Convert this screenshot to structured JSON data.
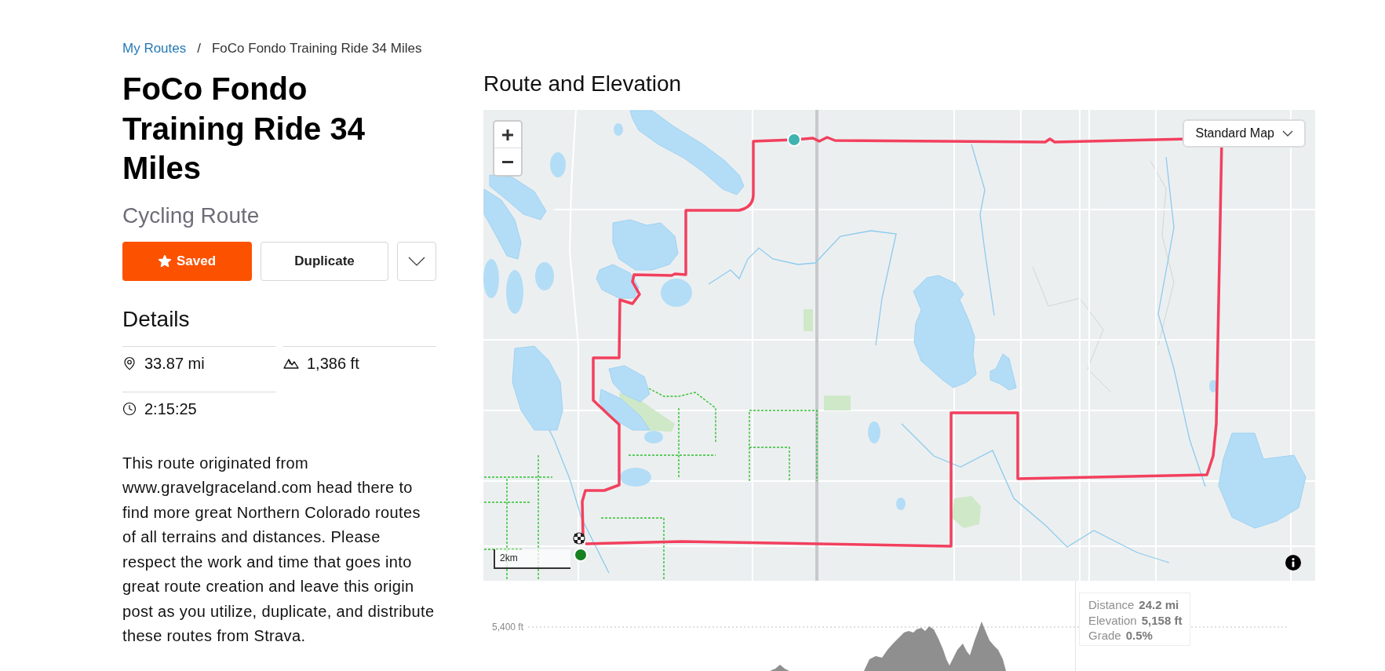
{
  "breadcrumb": {
    "separator": "/",
    "items": [
      {
        "kind": "link",
        "label": "My Routes"
      },
      {
        "kind": "current",
        "label": "FoCo Fondo Training Ride 34 Miles"
      }
    ]
  },
  "route": {
    "title": "FoCo Fondo Training Ride 34 Miles",
    "subtitle": "Cycling Route"
  },
  "actions": [
    {
      "kind": "save",
      "label": "Saved",
      "on": true
    },
    {
      "kind": "duplicate",
      "label": "Duplicate"
    },
    {
      "kind": "more"
    }
  ],
  "details": {
    "heading": "Details",
    "stats": [
      {
        "kind": "distance",
        "value": "33.87 mi"
      },
      {
        "kind": "elevation",
        "value": "1,386 ft"
      },
      {
        "kind": "time",
        "value": "2:15:25"
      }
    ]
  },
  "description": "This route originated from www.gravelgraceland.com head there to find more great Northern Colorado routes of all terrains and distances. Please respect the work and time that goes into great route creation and leave this origin post as you utilize, duplicate, and distribute these routes from Strava.",
  "route_and_elevation": {
    "heading": "Route and Elevation",
    "map": {
      "style_selector": "Standard Map",
      "scale": "2km"
    },
    "elevation": {
      "gridline_label": "5,400 ft",
      "tooltip": [
        {
          "label": "Distance",
          "value": "24.2 mi"
        },
        {
          "label": "Elevation",
          "value": "5,158 ft"
        },
        {
          "label": "Grade",
          "value": "0.5%"
        }
      ]
    }
  }
}
